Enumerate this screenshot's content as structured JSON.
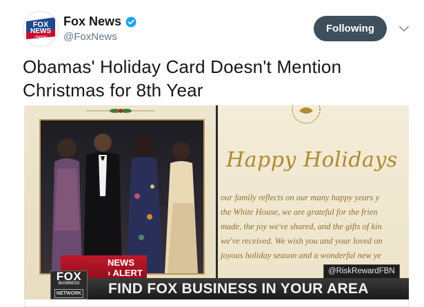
{
  "author": {
    "name": "Fox News",
    "handle": "@FoxNews",
    "verified": true,
    "avatar_text": {
      "line1": "FOX",
      "line2": "NEWS",
      "line3": "channel"
    }
  },
  "follow_button": {
    "label": "Following"
  },
  "tweet": {
    "text_line1": "Obamas' Holiday Card Doesn't Mention",
    "text_line2": "Christmas for 8th Year"
  },
  "media": {
    "card_heading": "Happy Holidays",
    "card_message": "our family reflects on our many happy years y\nthe White House, we are grateful for the frien\nmade, the joy we've shared, and the gifts of kin\nwe've received. We wish you and your loved on\njoyous holiday season and a wonderful new ye",
    "alert_line1": "NEWS",
    "alert_line2": "› ALERT",
    "channel_logo": {
      "top": "FOX",
      "middle": "BUSINESS",
      "bottom": "NETWORK"
    },
    "social_handle": "@RiskRewardFBN",
    "banner_text": "FIND FOX BUSINESS IN YOUR AREA"
  },
  "colors": {
    "follow_bg": "#3d4f5c",
    "verified_blue": "#1da1f2",
    "gold": "#b0892f",
    "alert_red": "#c0182a"
  }
}
